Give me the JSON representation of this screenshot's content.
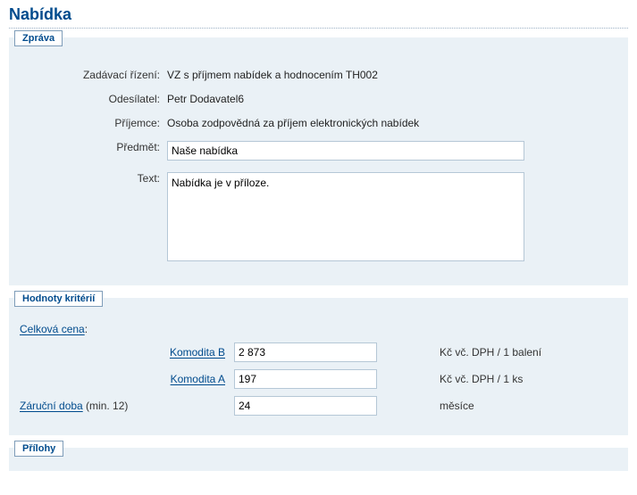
{
  "page_title": "Nabídka",
  "message_section": {
    "tab": "Zpráva",
    "fields": {
      "zadavaci_label": "Zadávací řízení:",
      "zadavaci_value": "VZ s příjmem nabídek a hodnocením TH002",
      "odesilatel_label": "Odesílatel:",
      "odesilatel_value": "Petr Dodavatel6",
      "prijemce_label": "Příjemce:",
      "prijemce_value": "Osoba zodpovědná za příjem elektronických nabídek",
      "predmet_label": "Předmět:",
      "predmet_value": "Naše nabídka",
      "text_label": "Text:",
      "text_value": "Nabídka je v příloze."
    }
  },
  "criteria_section": {
    "tab": "Hodnoty kritérií",
    "celkova_cena": "Celková cena",
    "komodita_b_label": "Komodita B",
    "komodita_b_value": "2 873",
    "komodita_b_unit": "Kč vč. DPH / 1 balení",
    "komodita_a_label": "Komodita A",
    "komodita_a_value": "197",
    "komodita_a_unit": "Kč vč. DPH / 1 ks",
    "zarucni_link": "Záruční doba",
    "zarucni_hint": " (min. 12)",
    "zarucni_value": "24",
    "zarucni_unit": "měsíce"
  },
  "attachments_section": {
    "tab": "Přílohy"
  }
}
